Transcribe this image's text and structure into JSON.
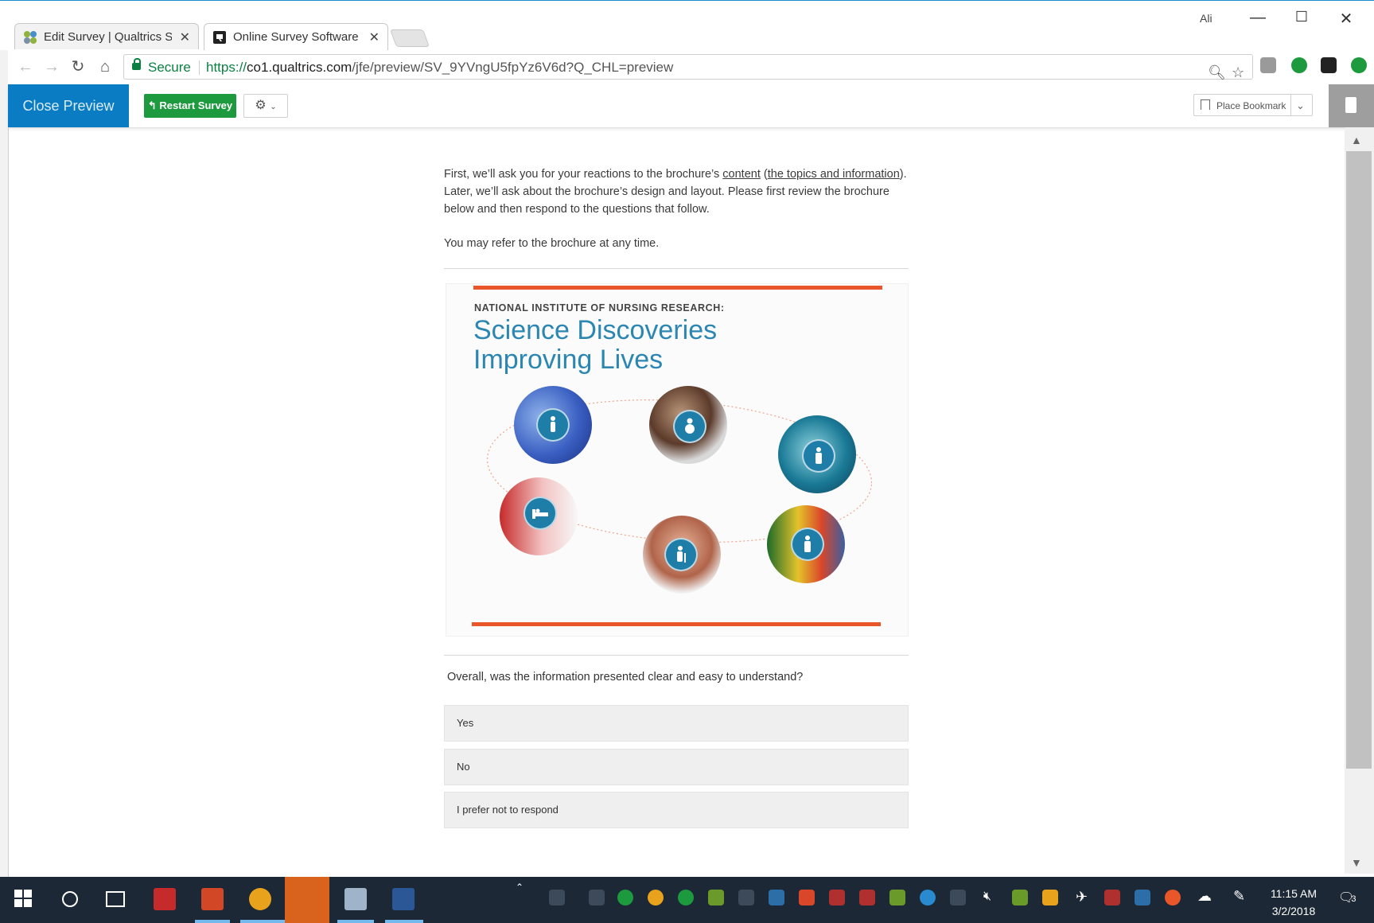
{
  "browser": {
    "tabs": [
      {
        "label": "Edit Survey | Qualtrics Su",
        "active": false
      },
      {
        "label": "Online Survey Software |",
        "active": true
      }
    ],
    "user_badge": "Ali",
    "url_secure_label": "Secure",
    "url_protocol": "https://",
    "url_host": "co1.qualtrics.com",
    "url_path": "/jfe/preview/SV_9YVngU5fpYz6V6d?Q_CHL=preview"
  },
  "preview_bar": {
    "close_label": "Close Preview",
    "restart_label": "Restart Survey",
    "bookmark_label": "Place Bookmark"
  },
  "survey": {
    "intro_part1": "First, we’ll ask you for your reactions to the brochure’s ",
    "intro_link1": "content",
    "intro_part2": " (",
    "intro_link2": "the topics and information",
    "intro_part3": "). Later, we’ll ask about the brochure’s design and layout. Please first review the brochure below and then respond to the questions that follow.",
    "refer_text": "You may refer to the brochure at any time.",
    "brochure": {
      "kicker": "NATIONAL INSTITUTE OF NURSING RESEARCH:",
      "title_line1": "Science Discoveries",
      "title_line2": "Improving Lives",
      "accent_color": "#e8562a",
      "title_color": "#2b86b2"
    },
    "question": "Overall, was the information presented clear and easy to understand?",
    "choices": [
      "Yes",
      "No",
      "I prefer not to respond"
    ]
  },
  "taskbar": {
    "time": "11:15 AM",
    "date": "3/2/2018",
    "notification_count": "3"
  }
}
